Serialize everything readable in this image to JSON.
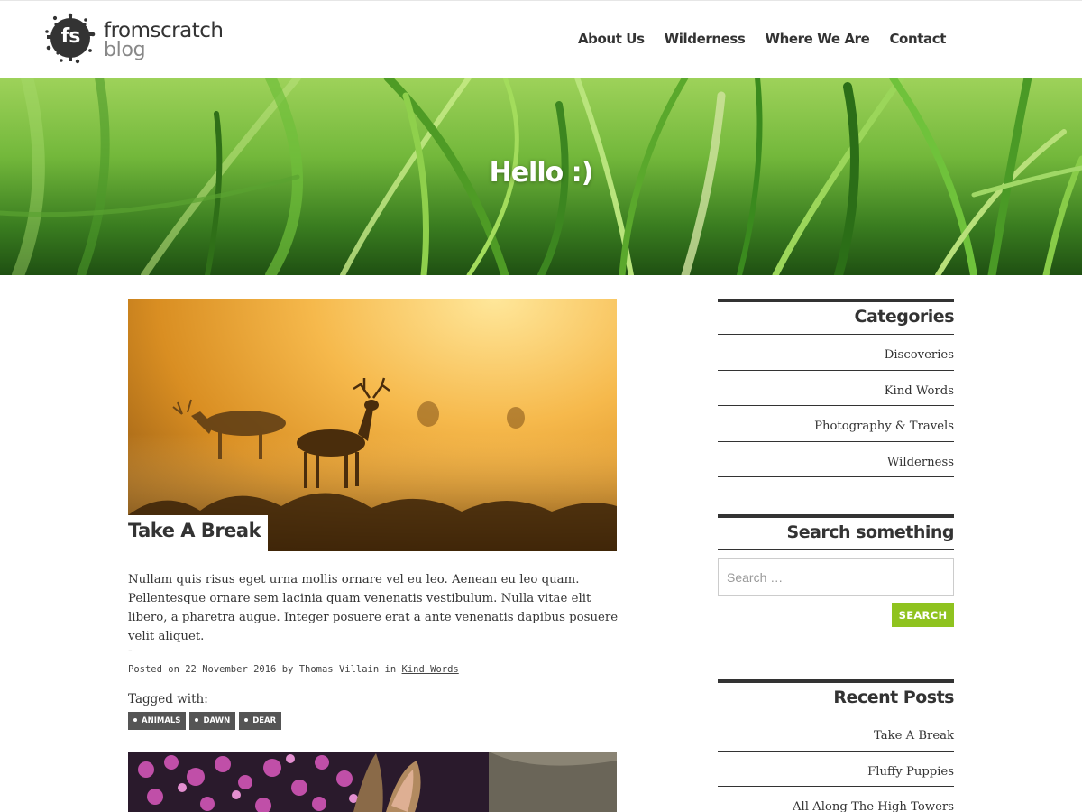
{
  "site": {
    "logo_line1": "fromscratch",
    "logo_line2": "blog",
    "logo_mark_text": "fs"
  },
  "nav": {
    "items": [
      {
        "label": "About Us"
      },
      {
        "label": "Wilderness"
      },
      {
        "label": "Where We Are"
      },
      {
        "label": "Contact"
      }
    ]
  },
  "hero": {
    "title": "Hello :)"
  },
  "post": {
    "title": "Take A Break",
    "excerpt": "Nullam quis risus eget urna mollis ornare vel eu leo. Aenean eu leo quam. Pellentesque ornare sem lacinia quam venenatis vestibulum. Nulla vitae elit libero, a pharetra augue. Integer posuere erat a ante venenatis dapibus posuere velit aliquet.",
    "separator": "-",
    "meta_prefix": "Posted on",
    "date": "22 November 2016",
    "meta_by": "by",
    "author": "Thomas Villain",
    "meta_in": "in",
    "category": "Kind Words",
    "tagged_label": "Tagged with:",
    "tags": [
      "ANIMALS",
      "DAWN",
      "DEAR"
    ]
  },
  "sidebar": {
    "categories": {
      "title": "Categories",
      "items": [
        "Discoveries",
        "Kind Words",
        "Photography & Travels",
        "Wilderness"
      ]
    },
    "search": {
      "title": "Search something",
      "placeholder": "Search …",
      "button_label": "SEARCH"
    },
    "recent": {
      "title": "Recent Posts",
      "items": [
        "Take A Break",
        "Fluffy Puppies",
        "All Along The High Towers"
      ]
    }
  },
  "colors": {
    "accent": "#8fc31f",
    "text": "#333333",
    "tag_bg": "#555555"
  }
}
